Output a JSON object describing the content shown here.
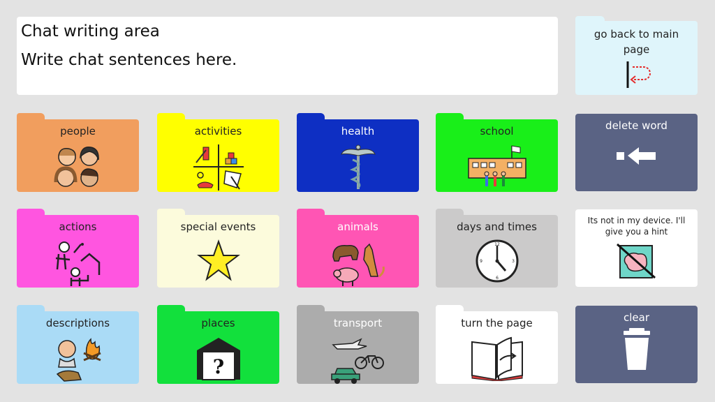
{
  "chat": {
    "title": "Chat writing area",
    "placeholder": "Write chat sentences here."
  },
  "go_back": {
    "label": "go back to main page"
  },
  "delete_word": {
    "label": "delete word"
  },
  "hint": {
    "label": "Its not in my device. I'll give you a hint"
  },
  "clear": {
    "label": "clear"
  },
  "folders": [
    {
      "label": "people",
      "color": "#f19e5e",
      "text_color": "#222222",
      "icon": "people-icon"
    },
    {
      "label": "activities",
      "color": "#ffff00",
      "text_color": "#222222",
      "icon": "activities-icon"
    },
    {
      "label": "health",
      "color": "#0e2fc3",
      "text_color": "#ffffff",
      "icon": "health-icon"
    },
    {
      "label": "school",
      "color": "#19ef19",
      "text_color": "#222222",
      "icon": "school-icon"
    },
    {
      "label": "actions",
      "color": "#ff55e0",
      "text_color": "#222222",
      "icon": "actions-icon"
    },
    {
      "label": "special events",
      "color": "#fcfbdc",
      "text_color": "#222222",
      "icon": "star-icon"
    },
    {
      "label": "animals",
      "color": "#ff55b4",
      "text_color": "#ffffff",
      "icon": "animals-icon"
    },
    {
      "label": "days and times",
      "color": "#cbcaca",
      "text_color": "#222222",
      "icon": "clock-icon"
    },
    {
      "label": "descriptions",
      "color": "#aadbf6",
      "text_color": "#222222",
      "icon": "descriptions-icon"
    },
    {
      "label": "places",
      "color": "#12e03c",
      "text_color": "#222222",
      "icon": "places-icon"
    },
    {
      "label": "transport",
      "color": "#acacac",
      "text_color": "#ffffff",
      "icon": "transport-icon"
    },
    {
      "label": "turn the page",
      "color": "#ffffff",
      "text_color": "#222222",
      "icon": "book-icon"
    }
  ],
  "colors": {
    "background": "#e3e3e3",
    "slate": "#5a6384",
    "go_back_bg": "#dff5fb"
  }
}
